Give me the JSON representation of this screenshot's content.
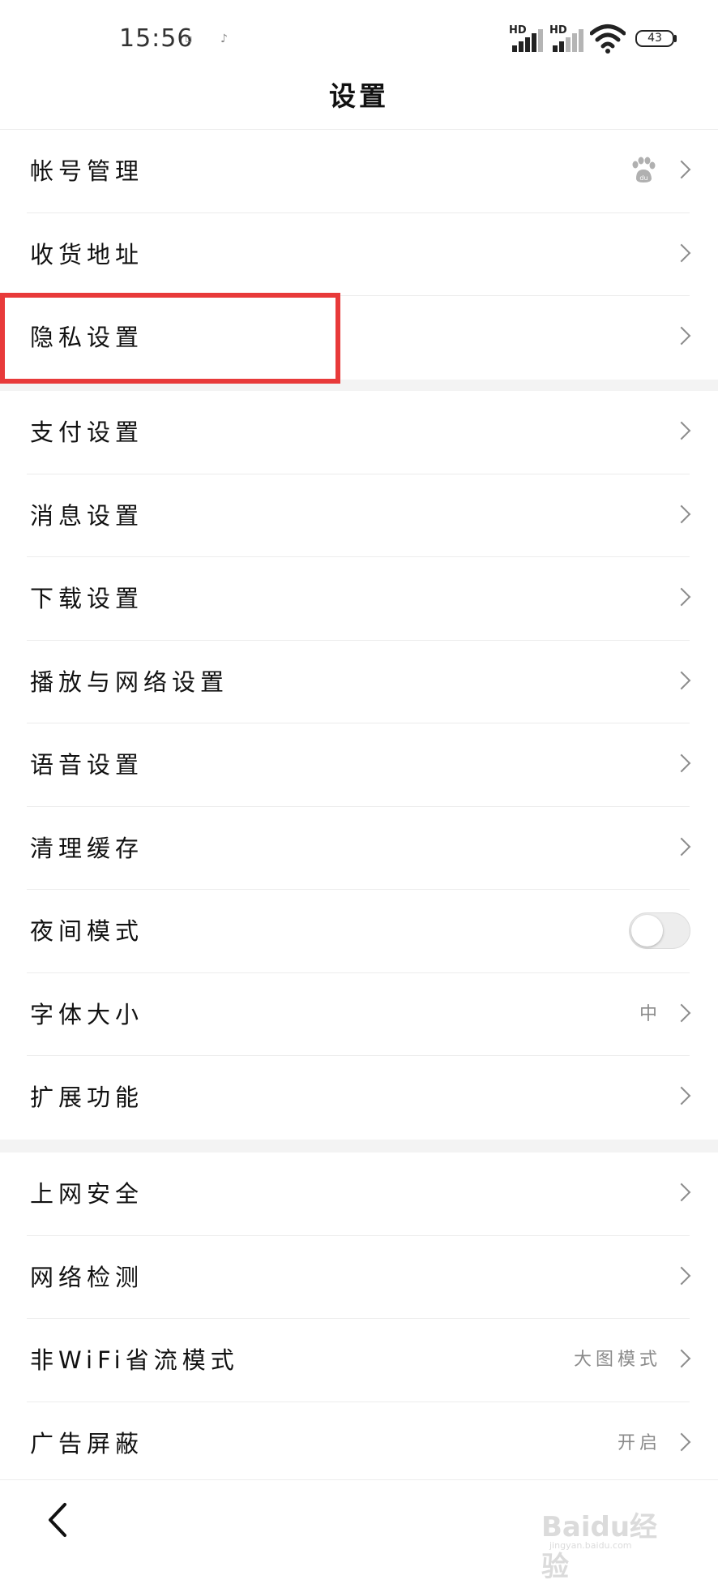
{
  "status_bar": {
    "time": "15:56",
    "battery": "43",
    "signal_label_1": "HD",
    "signal_label_2": "HD"
  },
  "header": {
    "title": "设置"
  },
  "groups": [
    {
      "items": [
        {
          "label": "帐号管理",
          "icon": "baidu-paw-icon"
        },
        {
          "label": "收货地址"
        },
        {
          "label": "隐私设置"
        }
      ]
    },
    {
      "items": [
        {
          "label": "支付设置"
        },
        {
          "label": "消息设置"
        },
        {
          "label": "下载设置"
        },
        {
          "label": "播放与网络设置"
        },
        {
          "label": "语音设置"
        },
        {
          "label": "清理缓存"
        },
        {
          "label": "夜间模式",
          "toggle": false
        },
        {
          "label": "字体大小",
          "value": "中"
        },
        {
          "label": "扩展功能"
        }
      ]
    },
    {
      "items": [
        {
          "label": "上网安全"
        },
        {
          "label": "网络检测"
        },
        {
          "label": "非WiFi省流模式",
          "value": "大图模式"
        },
        {
          "label": "广告屏蔽",
          "value": "开启"
        }
      ]
    }
  ],
  "highlight": {
    "target": "隐私设置",
    "color": "#e83a3a"
  },
  "watermark": {
    "text": "Baidu经验",
    "sub": "jingyan.baidu.com"
  }
}
